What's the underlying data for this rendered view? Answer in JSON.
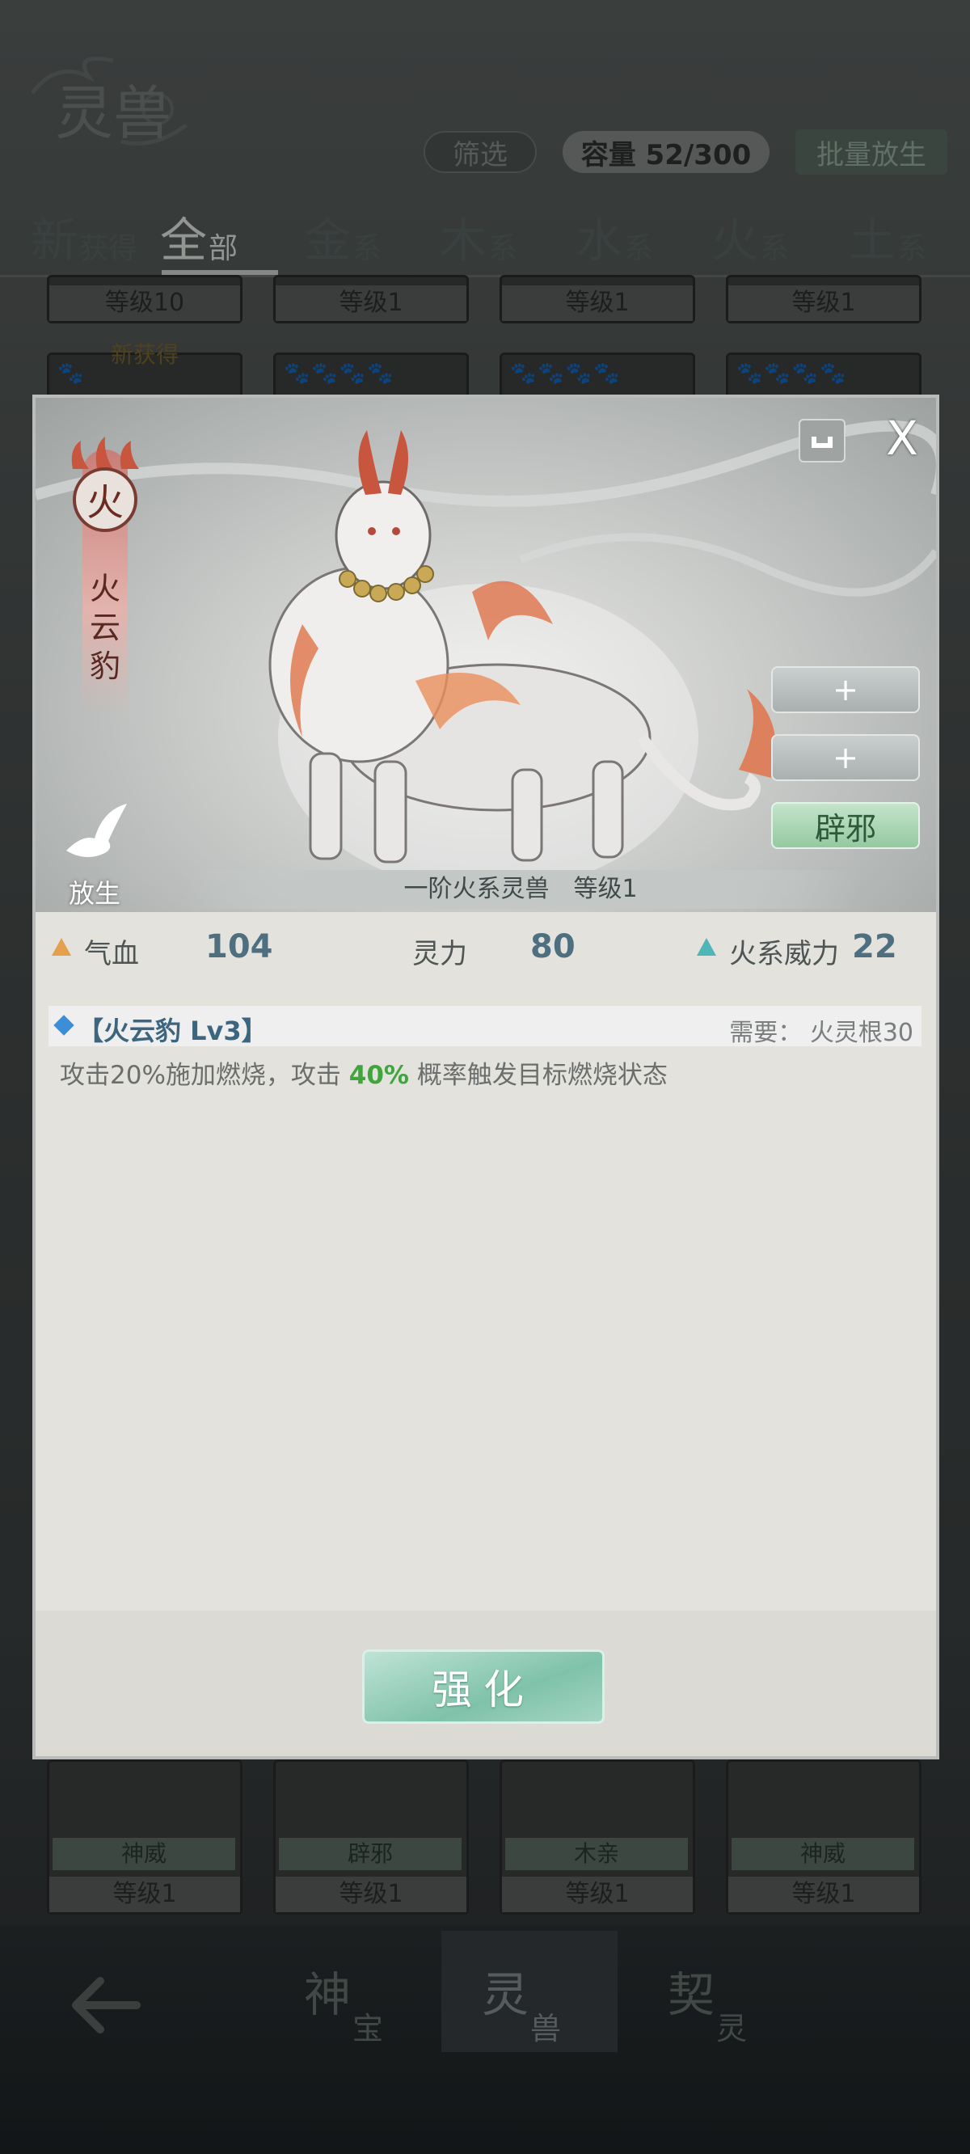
{
  "header": {
    "logo_text": "灵兽",
    "filter_label": "筛选",
    "capacity_label": "容量 52/300",
    "batch_release_label": "批量放生"
  },
  "tabs": [
    {
      "big": "新",
      "small": "获得"
    },
    {
      "big": "全",
      "small": "部"
    },
    {
      "big": "金",
      "small": "系"
    },
    {
      "big": "木",
      "small": "系"
    },
    {
      "big": "水",
      "small": "系"
    },
    {
      "big": "火",
      "small": "系"
    },
    {
      "big": "土",
      "small": "系"
    }
  ],
  "grid_top": {
    "levels": [
      "等级10",
      "等级1",
      "等级1",
      "等级1"
    ],
    "new_badge": "新获得"
  },
  "grid_bottom": [
    {
      "skill": "神威",
      "level": "等级1"
    },
    {
      "skill": "辟邪",
      "level": "等级1"
    },
    {
      "skill": "木亲",
      "level": "等级1"
    },
    {
      "skill": "神威",
      "level": "等级1"
    }
  ],
  "bottom_nav": [
    {
      "big": "神",
      "small": "宝"
    },
    {
      "big": "灵",
      "small": "兽"
    },
    {
      "big": "契",
      "small": "灵"
    }
  ],
  "modal": {
    "element_char": "火",
    "beast_name": "火云豹",
    "release_label": "放生",
    "plus_1": "+",
    "plus_2": "+",
    "skill_button": "辟邪",
    "close_symbol": "X",
    "caption": "一阶火系灵兽　等级1",
    "stats": {
      "hp_label": "气血",
      "hp_value": "104",
      "spirit_label": "灵力",
      "spirit_value": "80",
      "fire_label": "火系威力",
      "fire_value": "22"
    },
    "skill": {
      "name": "【火云豹 Lv3】",
      "requirement": "需要： 火灵根30",
      "desc_before": "攻击20%施加燃烧，攻击 ",
      "desc_highlight": "40%",
      "desc_after": " 概率触发目标燃烧状态"
    },
    "upgrade_label": "强化"
  },
  "colors": {
    "stat_value": "#4d6f80",
    "highlight": "#3fa53c",
    "fire_accent": "#c8553d"
  }
}
